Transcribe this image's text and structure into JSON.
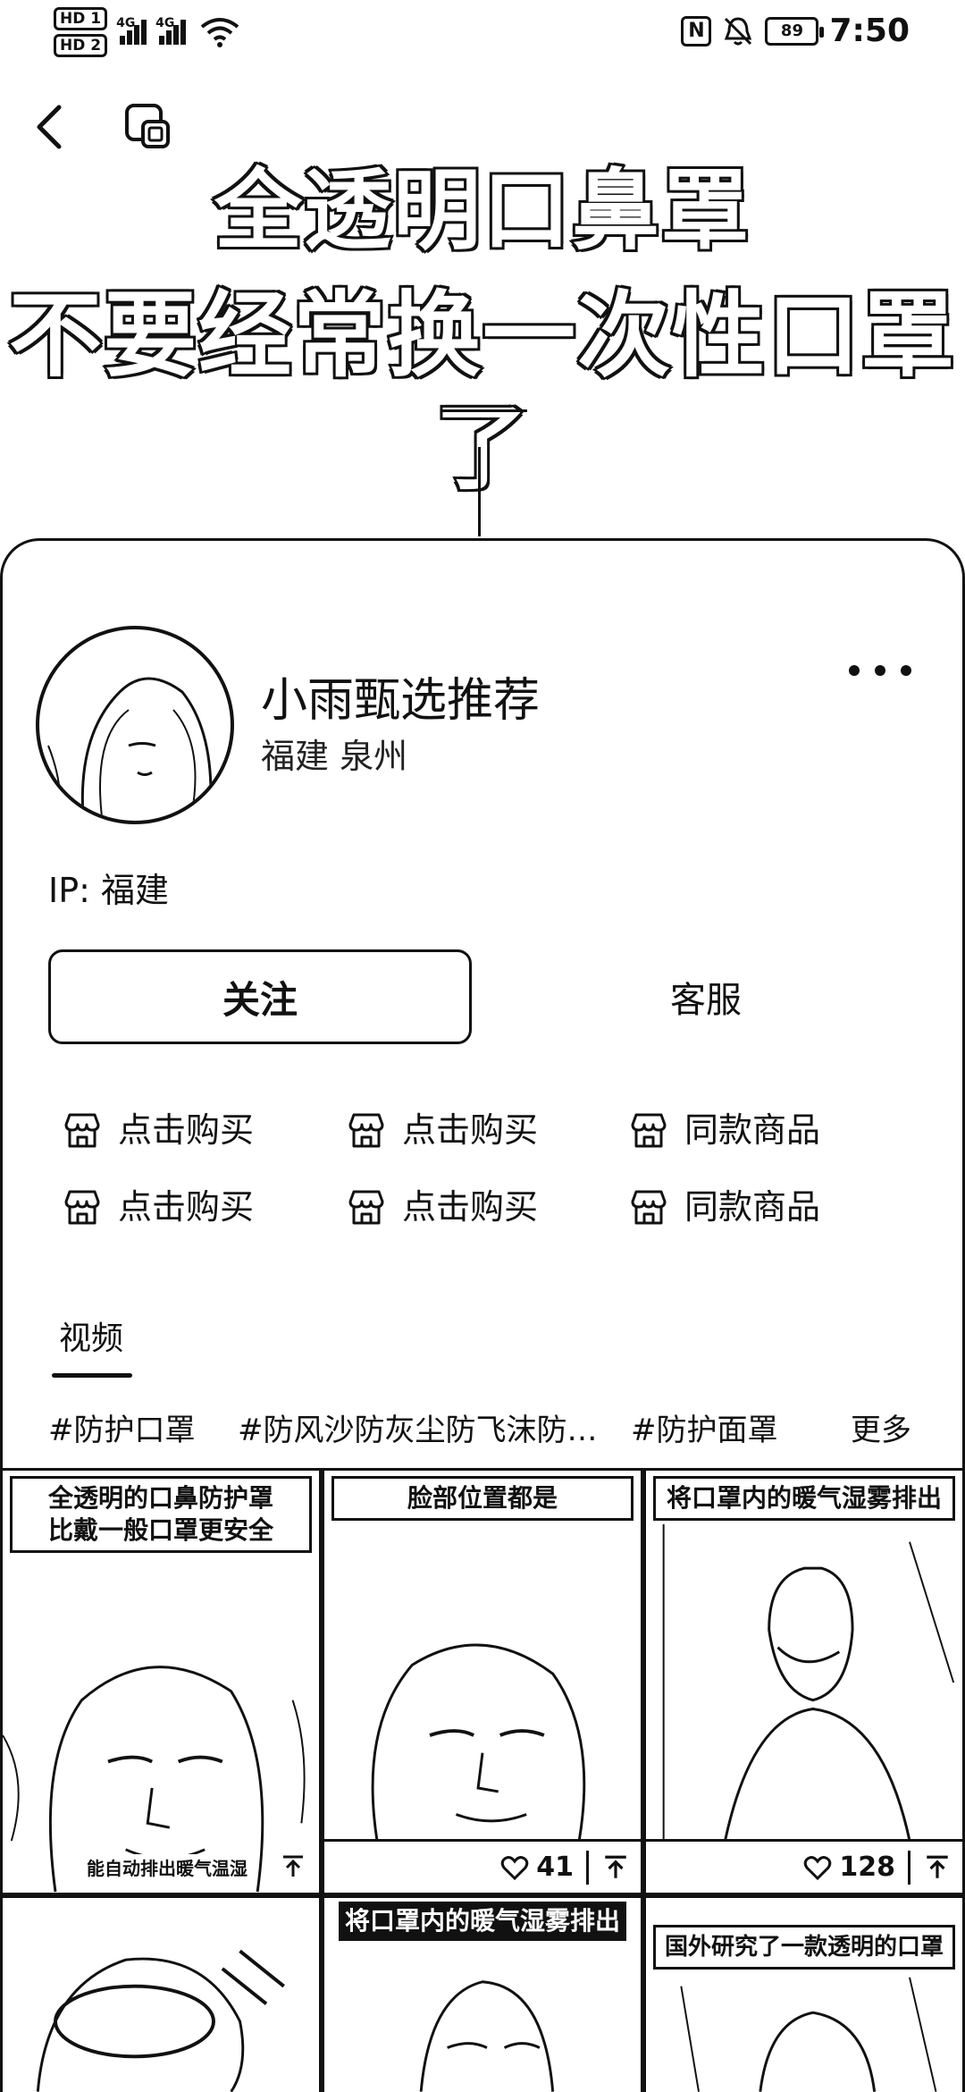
{
  "status_bar": {
    "hd1": "HD 1",
    "hd2": "HD 2",
    "net1": "4G",
    "net2": "4G",
    "nfc": "N",
    "battery": "89",
    "time": "7:50"
  },
  "headline": {
    "line1": "全透明口鼻罩",
    "line2": "不要经常换一次性口罩了"
  },
  "shop": {
    "name": "小雨甄选推荐",
    "location": "福建 泉州",
    "ip": "IP: 福建",
    "follow_label": "关注",
    "service_label": "客服"
  },
  "shop_links": [
    {
      "label": "点击购买",
      "icon": "store-icon"
    },
    {
      "label": "点击购买",
      "icon": "store-icon"
    },
    {
      "label": "同款商品",
      "icon": "store-icon"
    },
    {
      "label": "点击购买",
      "icon": "store-icon"
    },
    {
      "label": "点击购买",
      "icon": "store-icon"
    },
    {
      "label": "同款商品",
      "icon": "store-icon"
    }
  ],
  "tabs": {
    "video": "视频"
  },
  "hashtags": [
    "#防护口罩",
    "#防风沙防灰尘防飞沫防…",
    "#防护面罩"
  ],
  "hashtag_more": "更多",
  "videos": [
    {
      "caption_line1": "全透明的口鼻防护罩",
      "caption_line2": "比戴一般口罩更安全",
      "subtitle": "能自动排出暖气温湿",
      "likes": ""
    },
    {
      "caption_line1": "脸部位置都是",
      "caption_line2": "",
      "subtitle": "",
      "likes": "41"
    },
    {
      "caption_line1": "将口罩内的暖气湿雾排出",
      "caption_line2": "",
      "subtitle": "",
      "likes": "128"
    },
    {
      "caption_line1": "",
      "caption_line2": "",
      "subtitle": "",
      "likes": ""
    },
    {
      "caption_line1": "将口罩内的暖气湿雾排出",
      "caption_line2": "",
      "subtitle": "",
      "likes": ""
    },
    {
      "caption_line1": "国外研究了一款透明的口罩",
      "caption_line2": "",
      "subtitle": "",
      "likes": ""
    }
  ]
}
